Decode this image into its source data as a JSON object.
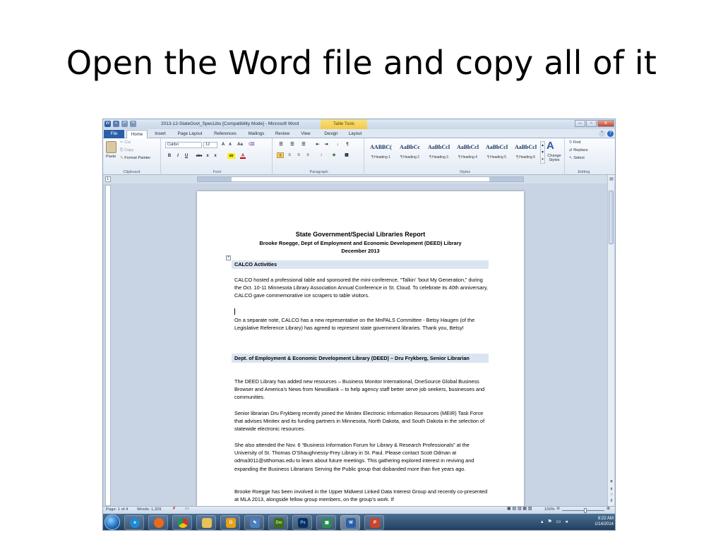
{
  "slide": {
    "title": "Open the Word file and copy all of it"
  },
  "window": {
    "title": "2013-12-StateGovt_SpecLibs [Compatibility Mode] - Microsoft Word",
    "context_tab": "Table Tools",
    "minimize": "–",
    "restore": "▫",
    "close": "x"
  },
  "tabs": [
    "File",
    "Home",
    "Insert",
    "Page Layout",
    "References",
    "Mailings",
    "Review",
    "View",
    "Design",
    "Layout"
  ],
  "ribbon": {
    "clipboard": {
      "paste": "Paste",
      "cut": "Cut",
      "copy": "Copy",
      "format_painter": "Format Painter",
      "label": "Clipboard"
    },
    "font": {
      "name": "Calibri",
      "size": "12",
      "grow": "A",
      "shrink": "A",
      "case": "Aa",
      "bold": "B",
      "italic": "I",
      "underline": "U",
      "strike": "abc",
      "subscript": "x",
      "superscript": "x",
      "highlight": "ab",
      "color": "A",
      "label": "Font"
    },
    "paragraph": {
      "label": "Paragraph",
      "pilcrow": "¶"
    },
    "styles": {
      "label": "Styles",
      "items": [
        {
          "sample": "AABBC(",
          "name": "¶ Heading 1"
        },
        {
          "sample": "AaBbCc",
          "name": "¶ Heading 2"
        },
        {
          "sample": "AaBbCcl",
          "name": "¶ Heading 3"
        },
        {
          "sample": "AaBbCcl",
          "name": "¶ Heading 4"
        },
        {
          "sample": "AaBbCcl",
          "name": "¶ Heading 5"
        },
        {
          "sample": "AaBbCcl",
          "name": "¶ Heading 6"
        }
      ],
      "change_styles": "Change Styles"
    },
    "editing": {
      "find": "Find",
      "replace": "Replace",
      "select": "Select",
      "label": "Editing"
    }
  },
  "document": {
    "title": "State Government/Special Libraries Report",
    "subtitle": "Brooke Roegge, Dept of Employment and Economic Development (DEED) Library",
    "date": "December 2013",
    "section1_heading": "CALCO Activities",
    "section1_p1": "CALCO hosted a professional table and sponsored the mini-conference, “Talkin’ ’bout My Generation,” during the Oct. 10-11 Minnesota Library Association Annual Conference in St. Cloud. To celebrate its 40th anniversary, CALCO gave commemorative ice scrapers to table visitors.",
    "section1_p2": "On a separate note, CALCO has a new representative on the MnPALS Committee - Betsy Haugen (of the Legislative Reference Library) has agreed to represent state government libraries. Thank you, Betsy!",
    "section2_heading": "Dept. of Employment & Economic Development Library (DEED) – Dru Frykberg, Senior Librarian",
    "section2_p1": "The DEED Library has added new resources – Business Monitor International, OneSource Global Business Browser and America’s News from NewsBank – to help agency staff better serve job seekers, businesses and communities.",
    "section2_p2": "Senior librarian Dru Frykberg recently joined the Minitex Electronic Information Resources (MEIR) Task Force that advises Minitex and its funding partners in Minnesota, North Dakota, and South Dakota in the selection of statewide electronic resources.",
    "section2_p3": "She also attended the Nov. 6 “Business Information Forum for Library & Research Professionals” at the University of St. Thomas O’Shaughnessy-Frey Library in St. Paul. Please contact Scott Odman at odma3011@stthomas.edu to learn about future meetings. This gathering explored interest in reviving and expanding the Business Librarians Serving the Public group that disbanded more than five years ago.",
    "section2_p4": "Brooke Roegge has been involved in the Upper Midwest Linked Data Interest Group and recently co-presented at MLA 2013, alongside fellow group members, on the group’s work. If"
  },
  "status": {
    "page": "Page: 1 of 4",
    "words": "Words: 1,329",
    "zoom": "100%"
  },
  "taskbar": {
    "apps": [
      "internet-explorer",
      "firefox",
      "chrome",
      "file-explorer",
      "outlook",
      "pen-tool",
      "dreamweaver",
      "photoshop",
      "spreadsheet",
      "word",
      "powerpoint"
    ],
    "labels": {
      "dreamweaver": "Dw",
      "photoshop": "Ps",
      "word": "W",
      "powerpoint": "P"
    },
    "time": "8:22 AM",
    "date": "1/14/2014"
  }
}
